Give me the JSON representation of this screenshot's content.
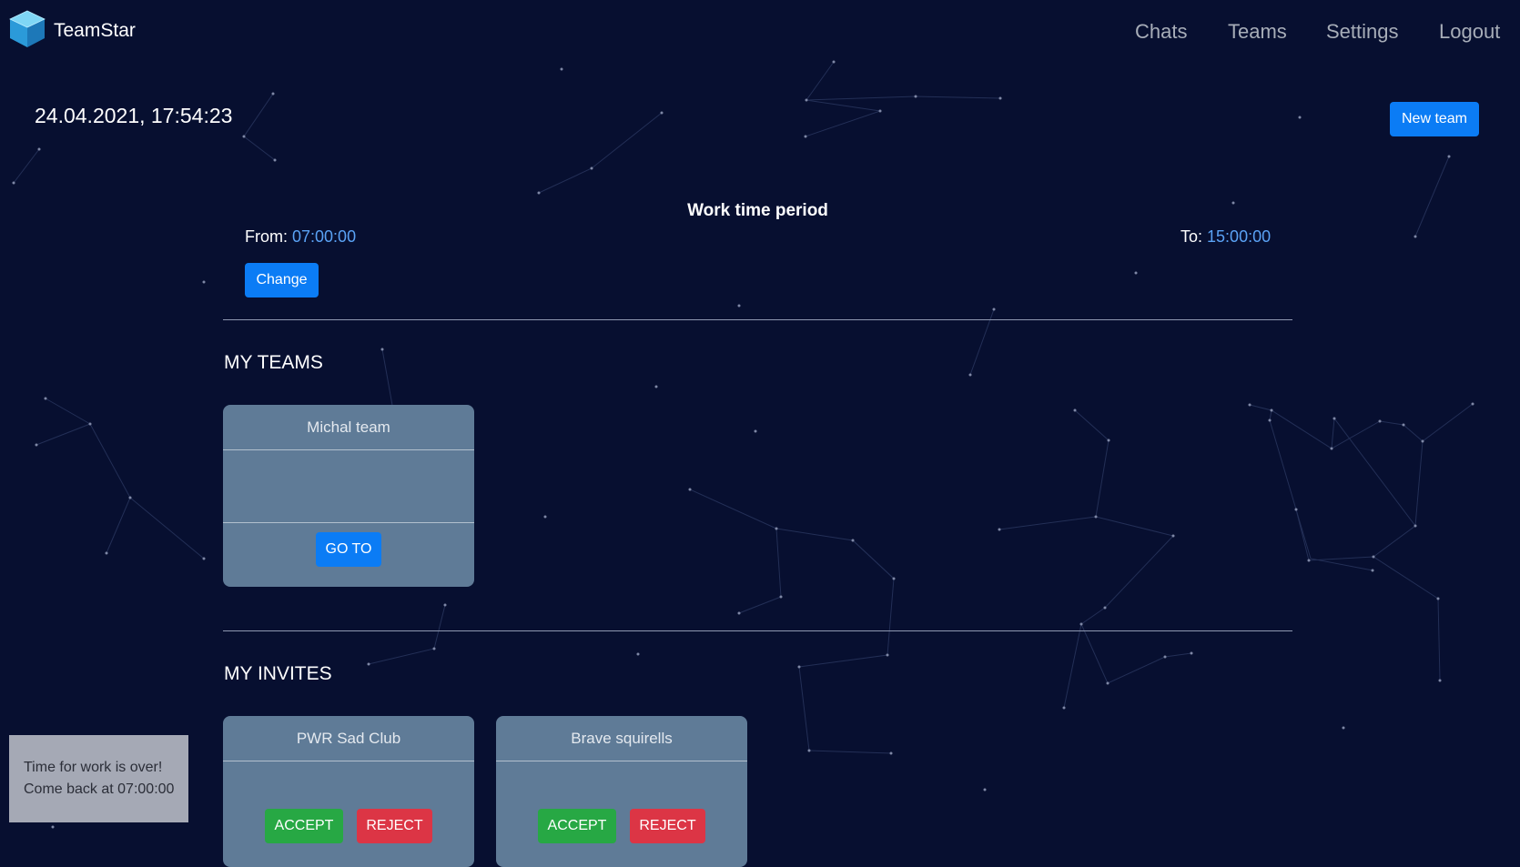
{
  "navbar": {
    "brand": "TeamStar",
    "links": [
      "Chats",
      "Teams",
      "Settings",
      "Logout"
    ]
  },
  "datetime": "24.04.2021, 17:54:23",
  "new_team_label": "New team",
  "work_time": {
    "title": "Work time period",
    "from_label": "From:",
    "from_value": "07:00:00",
    "to_label": "To:",
    "to_value": "15:00:00",
    "change_label": "Change"
  },
  "my_teams": {
    "title": "MY TEAMS",
    "teams": [
      {
        "name": "Michal team",
        "goto_label": "GO TO"
      }
    ]
  },
  "my_invites": {
    "title": "MY INVITES",
    "invites": [
      {
        "name": "PWR Sad Club",
        "accept_label": "ACCEPT",
        "reject_label": "REJECT"
      },
      {
        "name": "Brave squirells",
        "accept_label": "ACCEPT",
        "reject_label": "REJECT"
      }
    ]
  },
  "toast": {
    "line1": "Time for work is over!",
    "line2": "Come back at 07:00:00"
  },
  "colors": {
    "background": "#070f30",
    "primary": "#0b7cf5",
    "success": "#27a844",
    "danger": "#dc3545",
    "card": "#5f7b97",
    "time_value": "#5aa2f5"
  }
}
